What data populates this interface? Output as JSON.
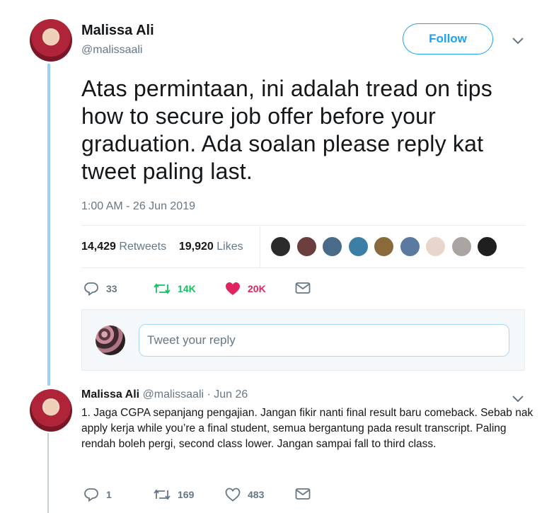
{
  "main_tweet": {
    "author_name": "Malissa Ali",
    "author_handle": "@malissaali",
    "follow_label": "Follow",
    "text": "Atas permintaan, ini adalah tread on tips how to secure job offer before your graduation. Ada soalan please reply kat tweet paling last.",
    "timestamp": "1:00 AM - 26 Jun 2019",
    "retweets_count": "14,429",
    "retweets_label": "Retweets",
    "likes_count": "19,920",
    "likes_label": "Likes",
    "actions": {
      "replies": "33",
      "retweets": "14K",
      "likes": "20K"
    },
    "liker_colors": [
      "#2b2b2b",
      "#6b3d3d",
      "#4a6a8a",
      "#3c7fa6",
      "#8a6a3a",
      "#5a7aa0",
      "#e8d6cc",
      "#a9a4a2",
      "#1f1f1f"
    ]
  },
  "reply_compose": {
    "placeholder": "Tweet your reply"
  },
  "reply_tweet": {
    "author_name": "Malissa Ali",
    "author_handle": "@malissaali",
    "separator": "·",
    "date": "Jun 26",
    "text": "1. Jaga CGPA sepanjang pengajian. Jangan fikir nanti final result baru comeback. Sebab nak apply kerja while you’re a final student, semua bergantung pada result transcript. Paling rendah boleh pergi, second class lower. Jangan sampai fall to third class.",
    "actions": {
      "replies": "1",
      "retweets": "169",
      "likes": "483"
    }
  },
  "colors": {
    "accent": "#1da1f2",
    "retweet_green": "#17bf63",
    "like_red": "#e0245e",
    "muted": "#657786"
  }
}
